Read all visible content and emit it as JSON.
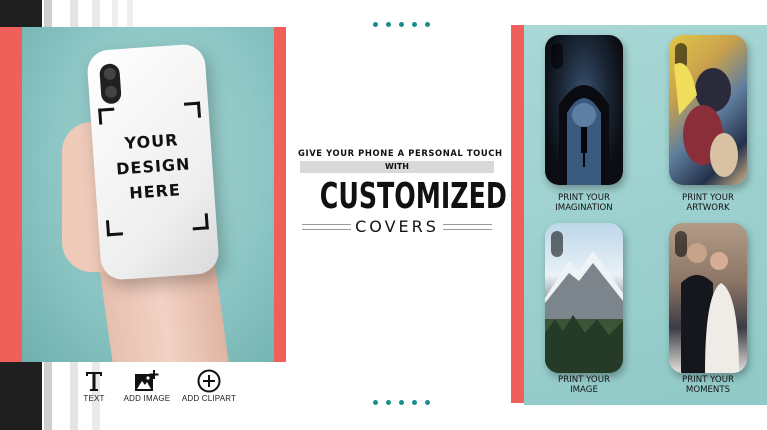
{
  "left_photo": {
    "phone_text": [
      "YOUR",
      "DESIGN",
      "HERE"
    ]
  },
  "tools": [
    {
      "label": "TEXT",
      "icon": "text-T-icon"
    },
    {
      "label": "ADD IMAGE",
      "icon": "add-image-icon"
    },
    {
      "label": "ADD CLIPART",
      "icon": "plus-circle-icon"
    }
  ],
  "headline": {
    "top": "GIVE YOUR PHONE A PERSONAL TOUCH",
    "with": "WITH",
    "main": "CUSTOMIZED",
    "sub": "COVERS"
  },
  "cases": [
    {
      "label_line1": "PRINT YOUR",
      "label_line2": "IMAGINATION"
    },
    {
      "label_line1": "PRINT YOUR",
      "label_line2": "ARTWORK"
    },
    {
      "label_line1": "PRINT YOUR",
      "label_line2": "IMAGE"
    },
    {
      "label_line1": "PRINT YOUR",
      "label_line2": "MOMENTS"
    }
  ],
  "colors": {
    "coral": "#f0605a",
    "teal": "#90c9c7",
    "dots": "#1a8c8a"
  }
}
